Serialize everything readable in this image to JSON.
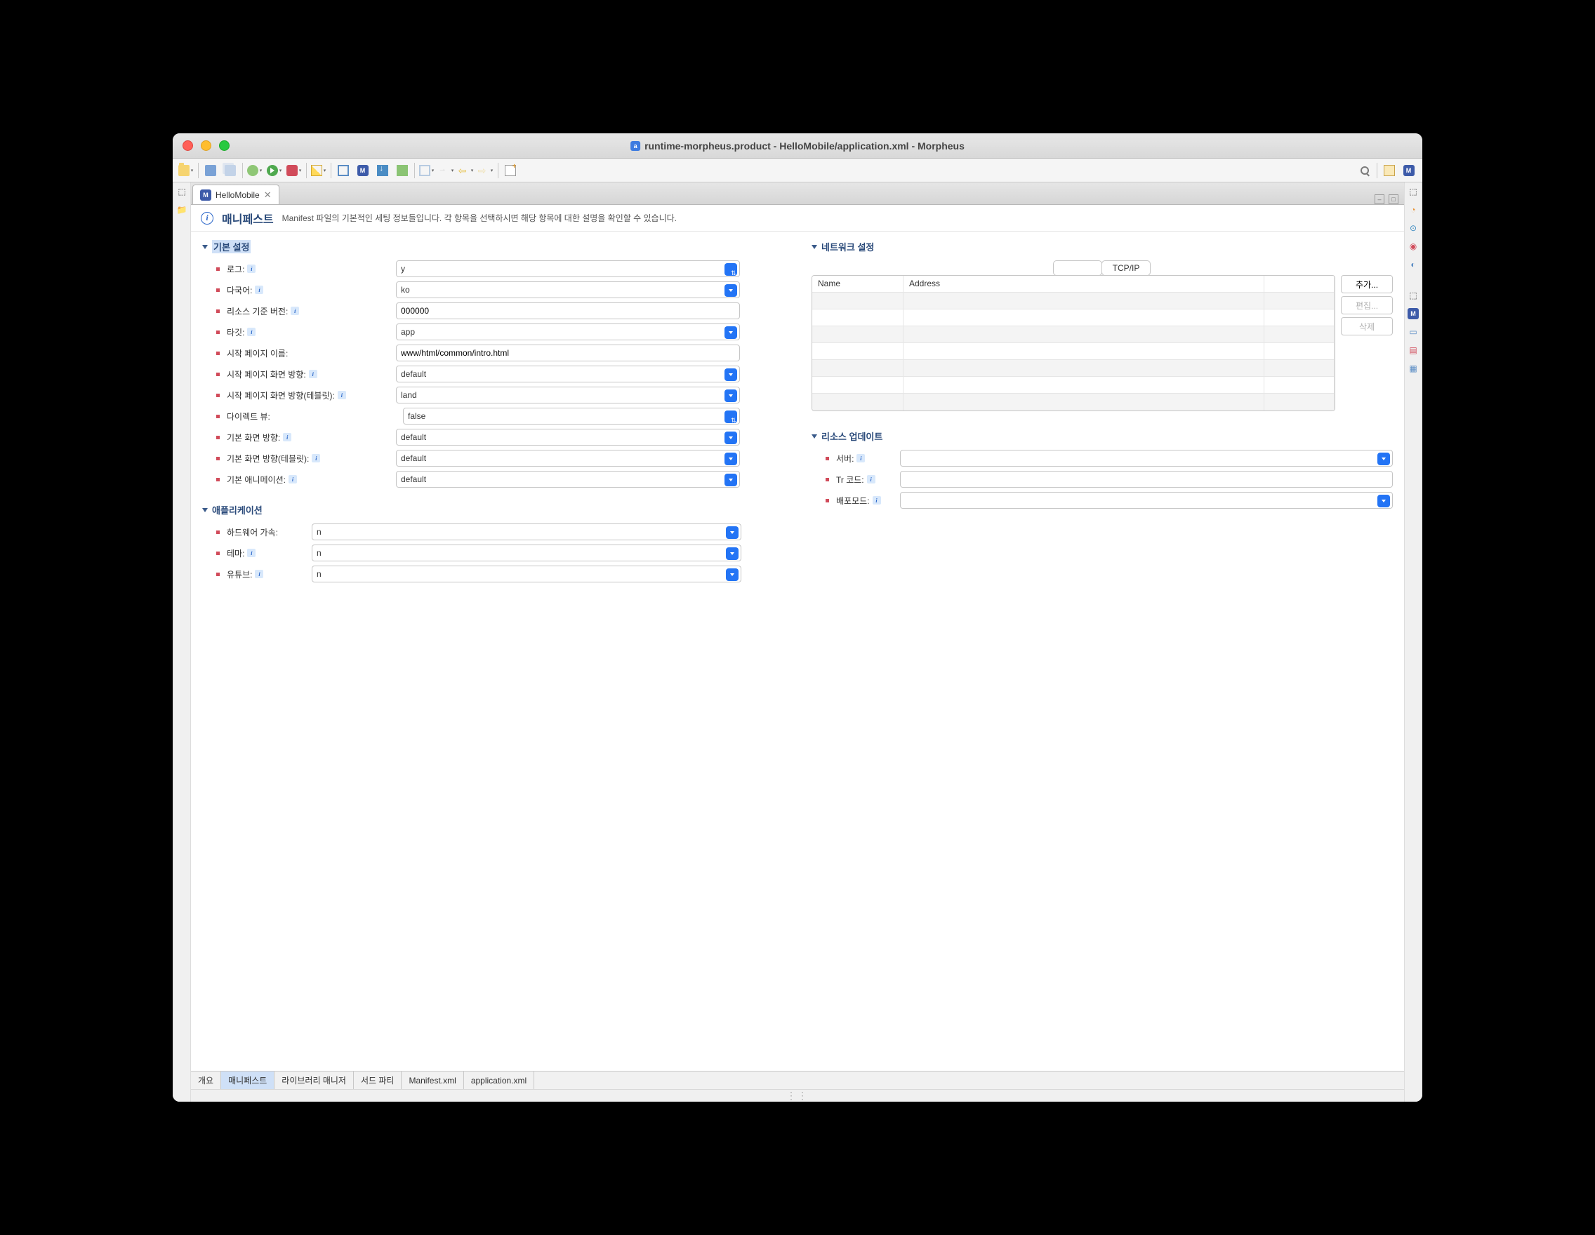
{
  "window": {
    "title": "runtime-morpheus.product - HelloMobile/application.xml - Morpheus"
  },
  "editor_tab": {
    "label": "HelloMobile"
  },
  "header": {
    "title": "매니페스트",
    "description": "Manifest 파일의 기본적인 세팅 정보들입니다. 각 항목을 선택하시면 해당 항목에 대한 설명을 확인할 수 있습니다."
  },
  "sections": {
    "basic": {
      "title": "기본 설정",
      "fields": {
        "log": {
          "label": "로그:",
          "value": "y"
        },
        "i18n": {
          "label": "다국어:",
          "value": "ko"
        },
        "resource_base_version": {
          "label": "리소스 기준 버전:",
          "value": "000000"
        },
        "target": {
          "label": "타깃:",
          "value": "app"
        },
        "start_page_name": {
          "label": "시작 페이지 이름:",
          "value": "www/html/common/intro.html"
        },
        "start_page_orientation": {
          "label": "시작 페이지 화면 방향:",
          "value": "default"
        },
        "start_page_orientation_tablet": {
          "label": "시작 페이지 화면 방향(테블릿):",
          "value": "land"
        },
        "direct_view": {
          "label": "다이렉트 뷰:",
          "value": "false"
        },
        "default_orientation": {
          "label": "기본 화면 방향:",
          "value": "default"
        },
        "default_orientation_tablet": {
          "label": "기본 화면 방향(테블릿):",
          "value": "default"
        },
        "default_animation": {
          "label": "기본 애니메이션:",
          "value": "default"
        }
      }
    },
    "application": {
      "title": "애플리케이션",
      "fields": {
        "hw_accel": {
          "label": "하드웨어 가속:",
          "value": "n"
        },
        "theme": {
          "label": "테마:",
          "value": "n"
        },
        "youtube": {
          "label": "유튜브:",
          "value": "n"
        }
      }
    },
    "network": {
      "title": "네트워크 설정",
      "tab_label": "TCP/IP",
      "columns": {
        "name": "Name",
        "address": "Address"
      },
      "buttons": {
        "add": "추가...",
        "edit": "편집...",
        "delete": "삭제"
      }
    },
    "resource_update": {
      "title": "리소스 업데이트",
      "fields": {
        "server": {
          "label": "서버:",
          "value": ""
        },
        "tr_code": {
          "label": "Tr 코드:",
          "value": ""
        },
        "deploy_mode": {
          "label": "배포모드:",
          "value": ""
        }
      }
    }
  },
  "bottom_tabs": {
    "overview": "개요",
    "manifest": "매니페스트",
    "library_manager": "라이브러리 매니저",
    "third_party": "서드 파티",
    "manifest_xml": "Manifest.xml",
    "application_xml": "application.xml"
  }
}
